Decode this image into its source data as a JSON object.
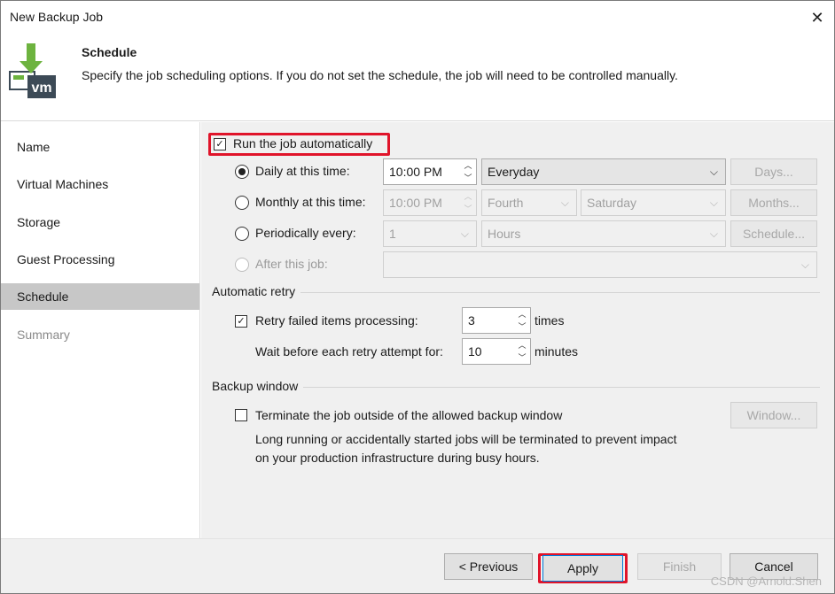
{
  "window": {
    "title": "New Backup Job",
    "close_glyph": "✕"
  },
  "header": {
    "title": "Schedule",
    "description": "Specify the job scheduling options. If you do not set the schedule, the job will need to be controlled manually.",
    "icon": "backup-vm-icon",
    "icon_text": "vm"
  },
  "nav": {
    "items": [
      {
        "label": "Name"
      },
      {
        "label": "Virtual Machines"
      },
      {
        "label": "Storage"
      },
      {
        "label": "Guest Processing"
      },
      {
        "label": "Schedule"
      },
      {
        "label": "Summary"
      }
    ]
  },
  "schedule": {
    "run_automatically": {
      "label": "Run the job automatically",
      "checked": true
    },
    "daily": {
      "label": "Daily at this time:",
      "time": "10:00 PM",
      "option": "Everyday",
      "button": "Days...",
      "selected": true
    },
    "monthly": {
      "label": "Monthly at this time:",
      "time": "10:00 PM",
      "week": "Fourth",
      "day": "Saturday",
      "button": "Months..."
    },
    "periodically": {
      "label": "Periodically every:",
      "value": "1",
      "unit": "Hours",
      "button": "Schedule..."
    },
    "after_job": {
      "label": "After this job:",
      "value": ""
    }
  },
  "retry": {
    "group_title": "Automatic retry",
    "retry_label": "Retry failed items processing:",
    "retry_checked": true,
    "retry_count": "3",
    "retry_unit": "times",
    "wait_label": "Wait before each retry attempt for:",
    "wait_value": "10",
    "wait_unit": "minutes"
  },
  "backup_window": {
    "group_title": "Backup window",
    "terminate_label": "Terminate the job outside of the allowed backup window",
    "terminate_checked": false,
    "button": "Window...",
    "note_line1": "Long running or accidentally started jobs will be terminated to prevent impact",
    "note_line2": "on your production infrastructure during busy hours."
  },
  "footer": {
    "previous": "< Previous",
    "apply": "Apply",
    "finish": "Finish",
    "cancel": "Cancel"
  },
  "watermark": "CSDN @Arnold.Shen",
  "colors": {
    "highlight": "#e0142a",
    "icon_green": "#6db33f",
    "icon_dark": "#3c4a56",
    "selected_nav": "#c7c7c7"
  }
}
